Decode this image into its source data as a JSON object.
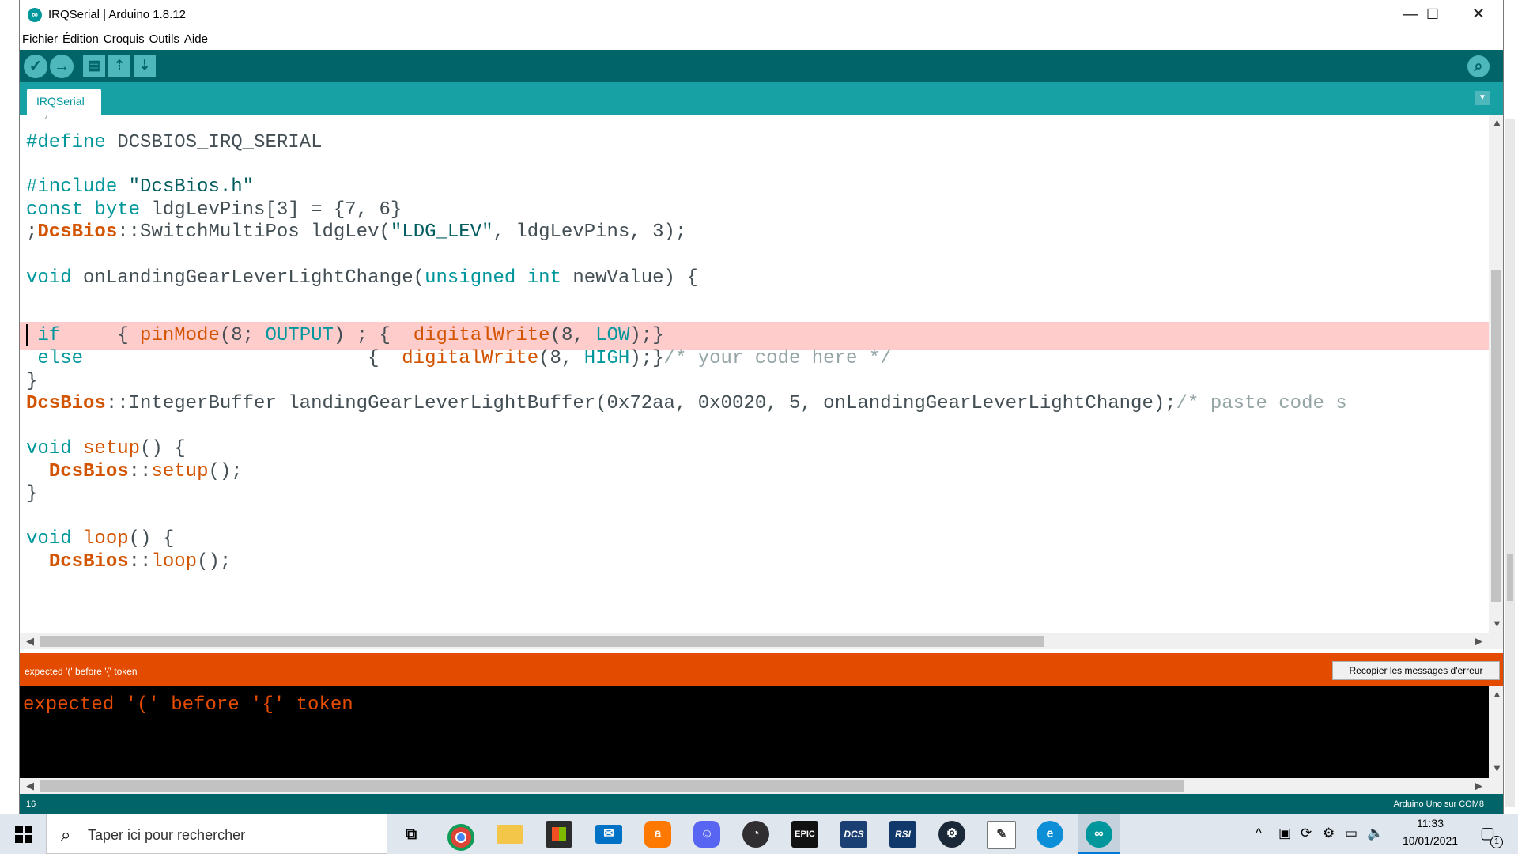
{
  "window": {
    "title": "IRQSerial | Arduino 1.8.12",
    "icon": "arduino-icon",
    "controls": {
      "minimize": "—",
      "maximize": "☐",
      "close": "✕"
    }
  },
  "menu": [
    "Fichier",
    "Édition",
    "Croquis",
    "Outils",
    "Aide"
  ],
  "toolbar": {
    "buttons": [
      "verify-icon",
      "upload-icon",
      "new-icon",
      "open-icon",
      "save-icon",
      "serial-monitor-icon"
    ],
    "verify": "✓",
    "upload": "→",
    "new": "▤",
    "open": "⇡",
    "save": "⇣",
    "serial": "⌕"
  },
  "tab": {
    "label": "IRQSerial",
    "menu": "▼"
  },
  "editor": {
    "current_line_highlight": "#ffcccc",
    "lines": {
      "l0": "*/",
      "l1_kw": "#define",
      "l1_rest": " DCSBIOS_IRQ_SERIAL",
      "l2_kw": "#include",
      "l2_sp": " ",
      "l2_str": "\"DcsBios.h\"",
      "l3_kw": "const",
      "l3_sp": " ",
      "l3_ty": "byte",
      "l3_rest": " ldgLevPins[3] = {7, 6}",
      "l4_a": ";",
      "l4_cls": "DcsBios",
      "l4_b": "::SwitchMultiPos ldgLev(",
      "l4_str": "\"LDG_LEV\"",
      "l4_c": ", ldgLevPins, 3);",
      "l5_kw": "void",
      "l5_a": " onLandingGearLeverLightChange(",
      "l5_ty1": "unsigned",
      "l5_sp": " ",
      "l5_ty2": "int",
      "l5_b": " newValue) {",
      "l6_pre": " ",
      "l6_kw": "if",
      "l6_a": "     { ",
      "l6_fn1": "pinMode",
      "l6_b": "(8; ",
      "l6_k1": "OUTPUT",
      "l6_c": ") ; {  ",
      "l6_fn2": "digitalWrite",
      "l6_d": "(8, ",
      "l6_k2": "LOW",
      "l6_e": ");}",
      "l7_pre": " ",
      "l7_kw": "else",
      "l7_a": "                         {  ",
      "l7_fn": "digitalWrite",
      "l7_b": "(8, ",
      "l7_k": "HIGH",
      "l7_c": ");}",
      "l7_cm": "/* your code here */",
      "l8": "}",
      "l9_cls": "DcsBios",
      "l9_a": "::IntegerBuffer landingGearLeverLightBuffer(0x72aa, 0x0020, 5, onLandingGearLeverLightChange);",
      "l9_cm": "/* paste code s",
      "l10_kw": "void",
      "l10_a": " ",
      "l10_fn": "setup",
      "l10_b": "() {",
      "l11_pre": "  ",
      "l11_cls": "DcsBios",
      "l11_a": "::",
      "l11_fn": "setup",
      "l11_b": "();",
      "l12": "}",
      "l13_kw": "void",
      "l13_a": " ",
      "l13_fn": "loop",
      "l13_b": "() {",
      "l14_pre": "  ",
      "l14_cls": "DcsBios",
      "l14_a": "::",
      "l14_fn": "loop",
      "l14_b": "();"
    }
  },
  "error_bar": {
    "message": "expected '(' before '{' token",
    "copy_button": "Recopier les messages d'erreur"
  },
  "console": {
    "text": "expected '(' before '{' token"
  },
  "status": {
    "line": "16",
    "board": "Arduino Uno sur COM8"
  },
  "taskbar": {
    "search_placeholder": "Taper ici pour rechercher",
    "apps": [
      "task-view-icon",
      "chrome-icon",
      "file-explorer-icon",
      "store-icon",
      "mail-icon",
      "avast-icon",
      "discord-icon",
      "obs-icon",
      "epic-games-icon",
      "dcs-icon",
      "rsi-icon",
      "steam-icon",
      "notepad-icon",
      "edge-icon",
      "arduino-icon"
    ],
    "app_labels": {
      "epic": "EPIC",
      "dcs": "DCS",
      "rsi": "RSI",
      "arduino": "∞"
    },
    "time": "11:33",
    "date": "10/01/2021",
    "notification_count": "1"
  }
}
